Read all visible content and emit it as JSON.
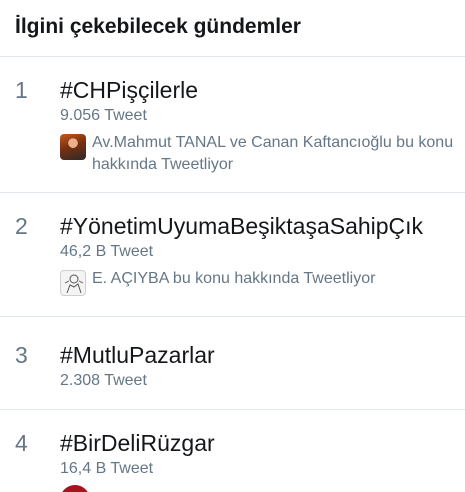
{
  "header": {
    "title": "İlgini çekebilecek gündemler"
  },
  "trends": [
    {
      "rank": "1",
      "name": "#CHPişçilerle",
      "count": "9.056 Tweet",
      "context": "Av.Mahmut TANAL ve Canan Kaftancıoğlu bu konu hakkında Tweetliyor",
      "avatar": "user-photo-avatar"
    },
    {
      "rank": "2",
      "name": "#YönetimUyumaBeşiktaşaSahipÇık",
      "count": "46,2 B Tweet",
      "context": "E. AÇIYBA bu konu hakkında Tweetliyor",
      "avatar": "user-sketch-avatar"
    },
    {
      "rank": "3",
      "name": "#MutluPazarlar",
      "count": "2.308 Tweet"
    },
    {
      "rank": "4",
      "name": "#BirDeliRüzgar",
      "count": "16,4 B Tweet",
      "avatar": "user-red-avatar"
    }
  ],
  "colors": {
    "primary_text": "#14171a",
    "secondary_text": "#657786",
    "divider": "#e1e8ed",
    "background": "#ffffff"
  }
}
